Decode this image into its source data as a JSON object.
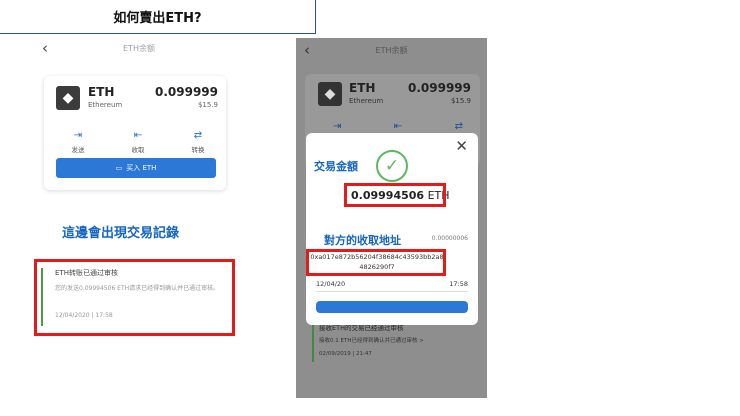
{
  "page": {
    "title": "如何賣出ETH?",
    "left_note": "這邊會出現交易記錄"
  },
  "left_phone": {
    "header_title": "ETH余额",
    "asset": {
      "symbol": "ETH",
      "name": "Ethereum",
      "amount": "0.099999",
      "fiat": "$15.9"
    },
    "actions": [
      {
        "icon": "send-icon",
        "label": "发送"
      },
      {
        "icon": "receive-icon",
        "label": "收取"
      },
      {
        "icon": "swap-icon",
        "label": "转换"
      }
    ],
    "buy_label": "买入 ETH",
    "transaction": {
      "title": "ETH转账已通过审核",
      "description": "您的发送0.09994506 ETH请求已经得到确认并已通过审核。",
      "time": "12/04/2020 | 17:58"
    }
  },
  "right_phone": {
    "header_title": "ETH余额",
    "asset": {
      "symbol": "ETH",
      "name": "Ethereum",
      "amount": "0.099999",
      "fiat": "$15.9"
    },
    "transaction": {
      "title": "接收ETH的交易已经通过审核",
      "description": "接收0.1 ETH已经得到确认并已通过审核 >",
      "time": "02/09/2019 | 21:47"
    },
    "modal": {
      "amount_label": "交易金額",
      "amount_value": "0.09994506",
      "amount_unit": "ETH",
      "address_label": "對方的收取地址",
      "small_number": "0.00000006",
      "address": "0xa017e872b56204f38684c43593bb2a84826290f7",
      "date": "12/04/20",
      "time": "17:58"
    }
  },
  "colors": {
    "accent_blue": "#2b78d6",
    "annotation_red": "#e31b1b",
    "label_blue": "#1565c0",
    "success_green": "#5cb85c"
  }
}
